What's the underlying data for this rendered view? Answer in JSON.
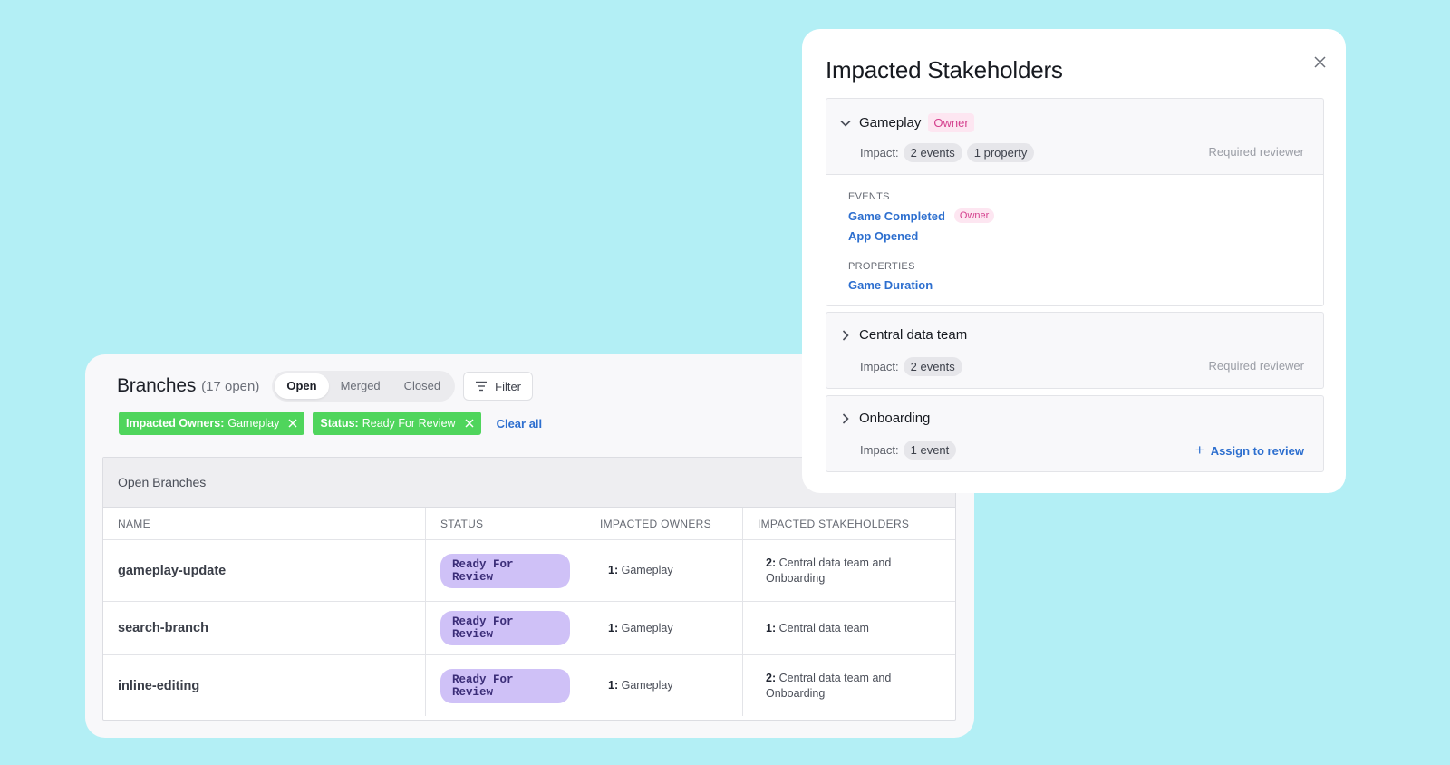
{
  "branches": {
    "title": "Branches",
    "count": "(17 open)",
    "tabs": [
      "Open",
      "Merged",
      "Closed"
    ],
    "active_tab": "Open",
    "filter_label": "Filter",
    "chips": [
      {
        "key": "Impacted Owners:",
        "value": "Gameplay"
      },
      {
        "key": "Status:",
        "value": "Ready For Review"
      }
    ],
    "clear_all": "Clear all",
    "table_title": "Open Branches",
    "columns": [
      "NAME",
      "STATUS",
      "IMPACTED OWNERS",
      "IMPACTED STAKEHOLDERS"
    ],
    "rows": [
      {
        "name": "gameplay-update",
        "status": "Ready For Review",
        "owners_count": "1:",
        "owners": "Gameplay",
        "stake_count": "2:",
        "stakeholders_line1": "Central data team and",
        "stakeholders_line2": "Onboarding"
      },
      {
        "name": "search-branch",
        "status": "Ready For Review",
        "owners_count": "1:",
        "owners": "Gameplay",
        "stake_count": "1:",
        "stakeholders_line1": "Central data team",
        "stakeholders_line2": ""
      },
      {
        "name": "inline-editing",
        "status": "Ready For Review",
        "owners_count": "1:",
        "owners": "Gameplay",
        "stake_count": "2:",
        "stakeholders_line1": "Central data team and",
        "stakeholders_line2": "Onboarding"
      }
    ],
    "chip_color": "#4fd55c",
    "status_color": "#cfc1f7"
  },
  "panel": {
    "title": "Impacted Stakeholders",
    "impact_label": "Impact:",
    "groups": [
      {
        "name": "Gameplay",
        "badge": "Owner",
        "impacts": [
          "2 events",
          "1 property"
        ],
        "right_text": "Required reviewer",
        "expanded": true,
        "events_label": "EVENTS",
        "events": [
          {
            "name": "Game Completed",
            "badge": "Owner"
          },
          {
            "name": "App Opened",
            "badge": ""
          }
        ],
        "properties_label": "PROPERTIES",
        "properties": [
          "Game Duration"
        ]
      },
      {
        "name": "Central data team",
        "impacts": [
          "2 events"
        ],
        "right_text": "Required reviewer",
        "expanded": false
      },
      {
        "name": "Onboarding",
        "impacts": [
          "1 event"
        ],
        "right_text": "Assign to review",
        "expanded": false
      }
    ],
    "icons": {
      "close": "close-icon",
      "expanded": "chevron-down-icon",
      "collapsed": "chevron-right-icon",
      "filter": "filter-icon",
      "add": "plus-icon"
    },
    "link_color": "#2d6fcf",
    "owner_badge_color": "#d43f8d"
  }
}
